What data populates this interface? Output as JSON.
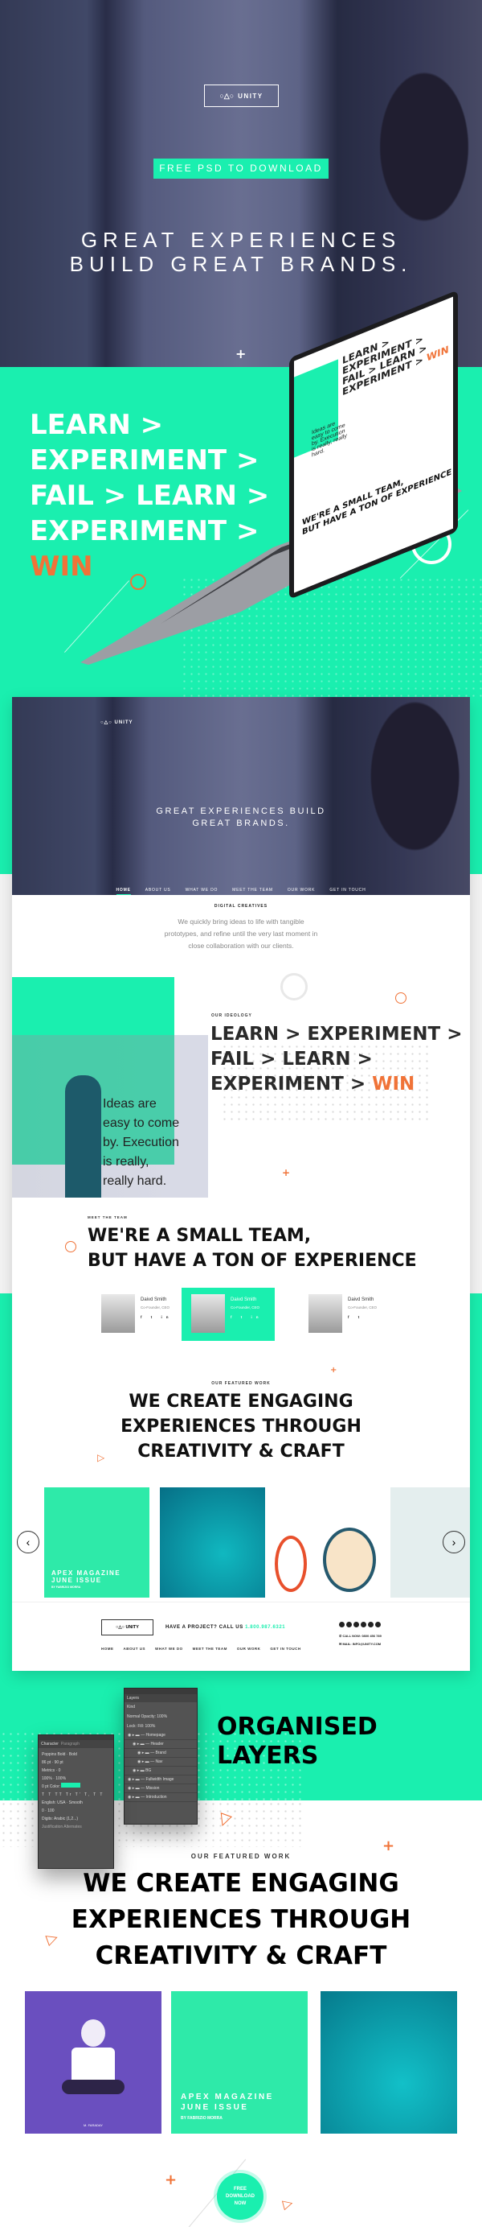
{
  "colors": {
    "accent": "#1aefaf",
    "orange": "#f07338",
    "text": "#111111"
  },
  "hero": {
    "logo": "UNITY",
    "logo_icon": "circle-triangle-circle-icon",
    "cta": "FREE PSD TO DOWNLOAD",
    "headline": [
      "GREAT EXPERIENCES",
      "BUILD GREAT BRANDS."
    ]
  },
  "laptop": {
    "screen_lines": [
      "LEARN > EXPERIMENT >",
      "FAIL > LEARN >",
      "EXPERIMENT > "
    ],
    "screen_win": "WIN",
    "screen_quote": "Ideas are easy to come by. Execution is really, really hard.",
    "screen_team": [
      "WE'RE A SMALL TEAM,",
      "BUT HAVE A TON OF EXPERIENCE"
    ]
  },
  "promo": {
    "lines": [
      "LEARN >",
      "EXPERIMENT >",
      "FAIL > LEARN >",
      "EXPERIMENT >"
    ],
    "win": "WIN"
  },
  "mockup": {
    "logo": "UNITY",
    "headline": [
      "GREAT EXPERIENCES BUILD",
      "GREAT BRANDS."
    ],
    "nav": [
      "HOME",
      "ABOUT US",
      "WHAT WE DO",
      "MEET THE TEAM",
      "OUR WORK",
      "GET IN TOUCH"
    ],
    "nav_active": "HOME",
    "intro": {
      "label": "DIGITAL CREATIVES",
      "text": "We quickly bring ideas to life with tangible prototypes, and refine until the very last moment in close collaboration with our clients."
    },
    "ideology": {
      "label": "OUR IDEOLOGY",
      "lines": [
        "LEARN > EXPERIMENT >",
        "FAIL > LEARN >",
        "EXPERIMENT > "
      ],
      "win": "WIN",
      "quote": [
        "Ideas are",
        "easy to come",
        "by. Execution",
        "is really,",
        "really hard."
      ]
    },
    "team": {
      "label": "MEET THE TEAM",
      "heading": [
        "WE'RE A SMALL TEAM,",
        "BUT HAVE A TON OF EXPERIENCE"
      ],
      "members": [
        {
          "name": "Daivd Smith",
          "role": "Co-Founder, CEO",
          "social": [
            "f",
            "t",
            "in"
          ]
        },
        {
          "name": "Daivd Smith",
          "role": "Co-Founder, CEO",
          "social": [
            "f",
            "t",
            "in"
          ],
          "highlighted": true
        },
        {
          "name": "Daivd Smith",
          "role": "Co-Founder, CEO",
          "social": [
            "f",
            "t"
          ]
        }
      ]
    },
    "work": {
      "label": "OUR FEATURED WORK",
      "heading": [
        "WE CREATE ENGAGING",
        "EXPERIENCES THROUGH",
        "CREATIVITY & CRAFT"
      ],
      "tiles": [
        {
          "title": [
            "APEX MAGAZINE",
            "JUNE ISSUE"
          ],
          "byline": "BY FABRIZIO MORRA"
        },
        {
          "title": []
        },
        {
          "title": []
        },
        {
          "title": []
        }
      ]
    },
    "footer": {
      "logo": "UNITY",
      "cta": "HAVE A PROJECT? CALL US",
      "phone": "1.800.987.6321",
      "nav": [
        "HOME",
        "ABOUT US",
        "WHAT WE DO",
        "MEET THE TEAM",
        "OUR WORK",
        "GET IN TOUCH"
      ],
      "call": "CALL NOW: 0800 456 789",
      "mail": "MAIL: INFO@UNITY.COM",
      "social_count": 6
    }
  },
  "layers": {
    "heading": [
      "ORGANISED",
      "LAYERS"
    ],
    "layers_panel": {
      "title": "Layers",
      "kind": "Kind",
      "blend": "Normal",
      "opacity_label": "Opacity:",
      "opacity": "100%",
      "lock_label": "Lock:",
      "fill_label": "Fill:",
      "fill": "100%",
      "rows": [
        "— Homepage",
        "— Header",
        "— Brand",
        "— Nav",
        "BG",
        "— Fullwidth Image",
        "— Mission",
        "— Introduction"
      ]
    },
    "character_panel": {
      "tabs": [
        "Character",
        "Paragraph"
      ],
      "font": "Poppins Bold",
      "style": "Bold",
      "size": "86 pt",
      "leading": "90 pt",
      "kerning": "Metrics",
      "tracking": "0",
      "vscale": "100%",
      "hscale": "100%",
      "baseline": "0 pt",
      "color_label": "Color:",
      "language": "English: USA",
      "aa": "Smooth",
      "digits_label": "Digits:",
      "digits": "Arabic (1,2...)",
      "justification": "Justification Alternates",
      "v1": "0",
      "v2": "100"
    }
  },
  "featured": {
    "label": "OUR FEATURED WORK",
    "heading": [
      "WE CREATE ENGAGING",
      "EXPERIENCES THROUGH",
      "CREATIVITY & CRAFT"
    ],
    "tiles": [
      {
        "caption": "M. FARADAY"
      },
      {
        "title": [
          "APEX MAGAZINE",
          "JUNE ISSUE"
        ],
        "byline": "BY FABRIZIO MORRA"
      },
      {
        "caption": ""
      }
    ]
  },
  "badge": {
    "lines": [
      "FREE",
      "DOWNLOAD",
      "NOW"
    ]
  }
}
